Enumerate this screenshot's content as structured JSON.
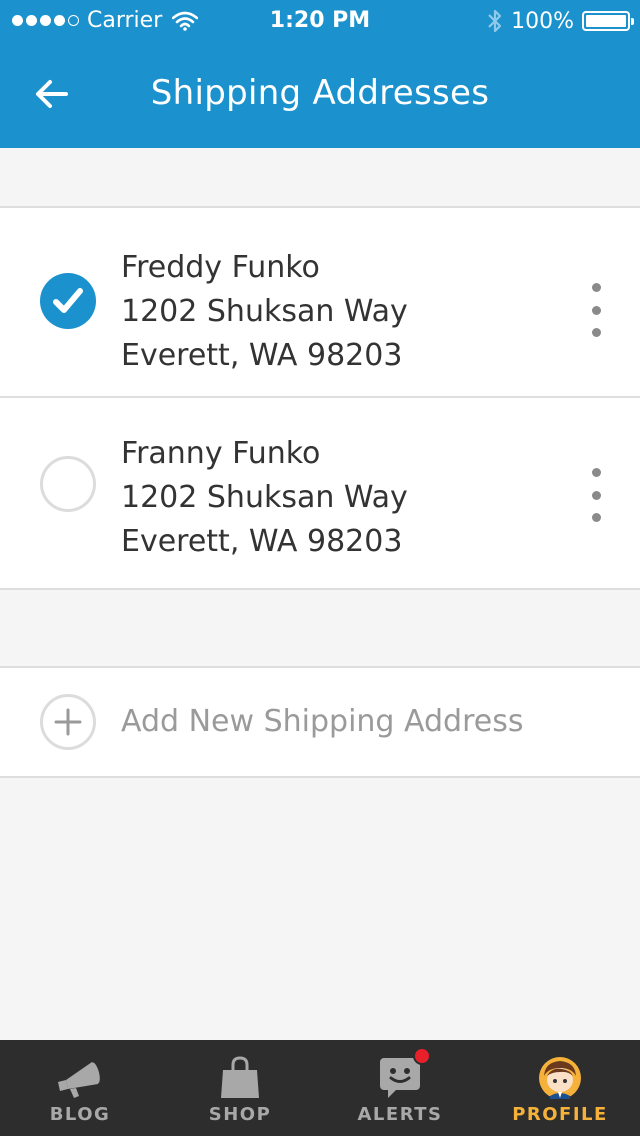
{
  "status_bar": {
    "carrier": "Carrier",
    "time": "1:20 PM",
    "battery": "100%",
    "signal_bars_filled": 4,
    "signal_bars_total": 5
  },
  "header": {
    "title": "Shipping Addresses",
    "back_icon": "arrow-left-icon"
  },
  "addresses": [
    {
      "name": "Freddy Funko",
      "street": "1202 Shuksan Way",
      "city": "Everett, WA 98203",
      "selected": true
    },
    {
      "name": "Franny Funko",
      "street": "1202 Shuksan Way",
      "city": "Everett, WA 98203",
      "selected": false
    }
  ],
  "add_address": {
    "label": "Add New Shipping Address",
    "icon": "plus-circle-icon"
  },
  "tabs": [
    {
      "label": "BLOG",
      "icon": "megaphone-icon",
      "active": false
    },
    {
      "label": "SHOP",
      "icon": "shopping-bag-icon",
      "active": false
    },
    {
      "label": "ALERTS",
      "icon": "chat-face-icon",
      "active": false,
      "badge": true
    },
    {
      "label": "PROFILE",
      "icon": "avatar-icon",
      "active": true
    }
  ],
  "colors": {
    "primary": "#1b92cd",
    "tab_bar_bg": "#2d2d2d",
    "tab_active": "#f5b13a",
    "tab_inactive": "#a8a8a8",
    "badge": "#e8202a"
  }
}
